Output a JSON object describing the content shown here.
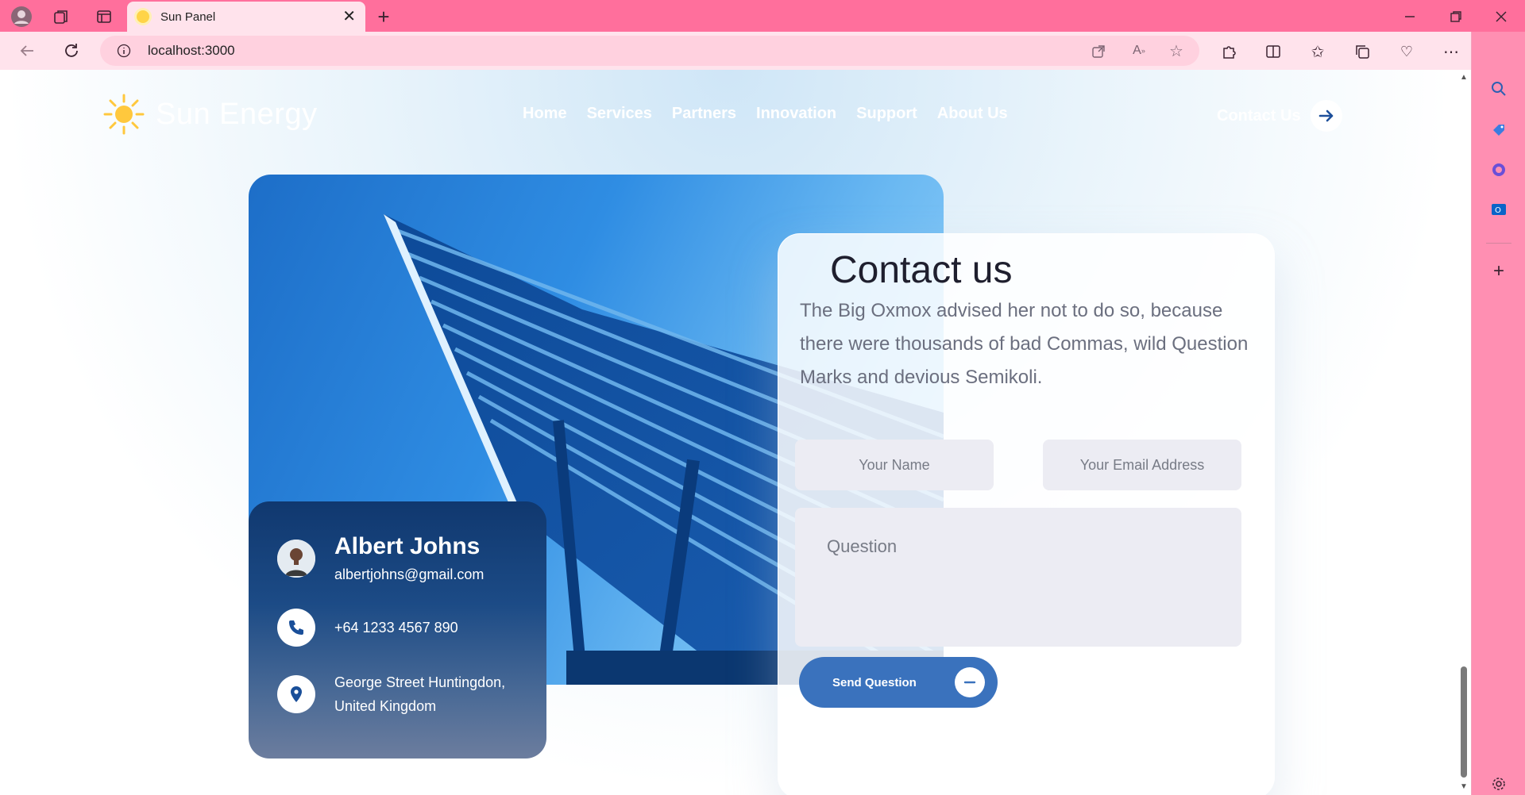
{
  "browser": {
    "tab_title": "Sun Panel",
    "url": "localhost:3000"
  },
  "site": {
    "brand": "Sun Energy",
    "nav": [
      "Home",
      "Services",
      "Partners",
      "Innovation",
      "Support",
      "About Us"
    ],
    "contact_link": "Contact Us"
  },
  "info_card": {
    "name": "Albert Johns",
    "email": "albertjohns@gmail.com",
    "phone": "+64 1233 4567 890",
    "address_line1": "George Street Huntingdon,",
    "address_line2": "United Kingdom"
  },
  "contact_form": {
    "title": "Contact us",
    "description": "The Big Oxmox advised her not to do so, because there were thousands of bad Commas, wild Question Marks and devious Semikoli.",
    "name_placeholder": "Your Name",
    "email_placeholder": "Your Email Address",
    "question_placeholder": "Question",
    "submit_label": "Send Question"
  },
  "colors": {
    "chrome": "#ff6f9c",
    "accent_blue": "#3a72bd",
    "card_navy": "#10386f"
  }
}
